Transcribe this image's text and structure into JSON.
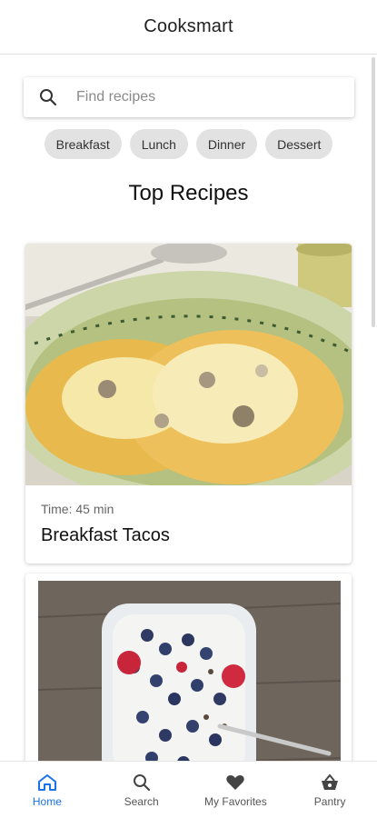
{
  "app": {
    "title": "Cooksmart"
  },
  "search": {
    "placeholder": "Find recipes",
    "value": ""
  },
  "categories": [
    {
      "label": "Breakfast"
    },
    {
      "label": "Lunch"
    },
    {
      "label": "Dinner"
    },
    {
      "label": "Dessert"
    }
  ],
  "section": {
    "title": "Top Recipes"
  },
  "recipes": [
    {
      "time": "Time: 45 min",
      "name": "Breakfast Tacos",
      "image_icon": "breakfast-tacos-photo"
    },
    {
      "time": "",
      "name": "",
      "image_icon": "yogurt-berries-photo"
    }
  ],
  "nav": {
    "items": [
      {
        "label": "Home",
        "icon": "home-icon",
        "active": true
      },
      {
        "label": "Search",
        "icon": "search-icon",
        "active": false
      },
      {
        "label": "My Favorites",
        "icon": "heart-icon",
        "active": false
      },
      {
        "label": "Pantry",
        "icon": "basket-icon",
        "active": false
      }
    ]
  },
  "colors": {
    "accent": "#1a73e8",
    "chip_bg": "#e2e2e2"
  }
}
